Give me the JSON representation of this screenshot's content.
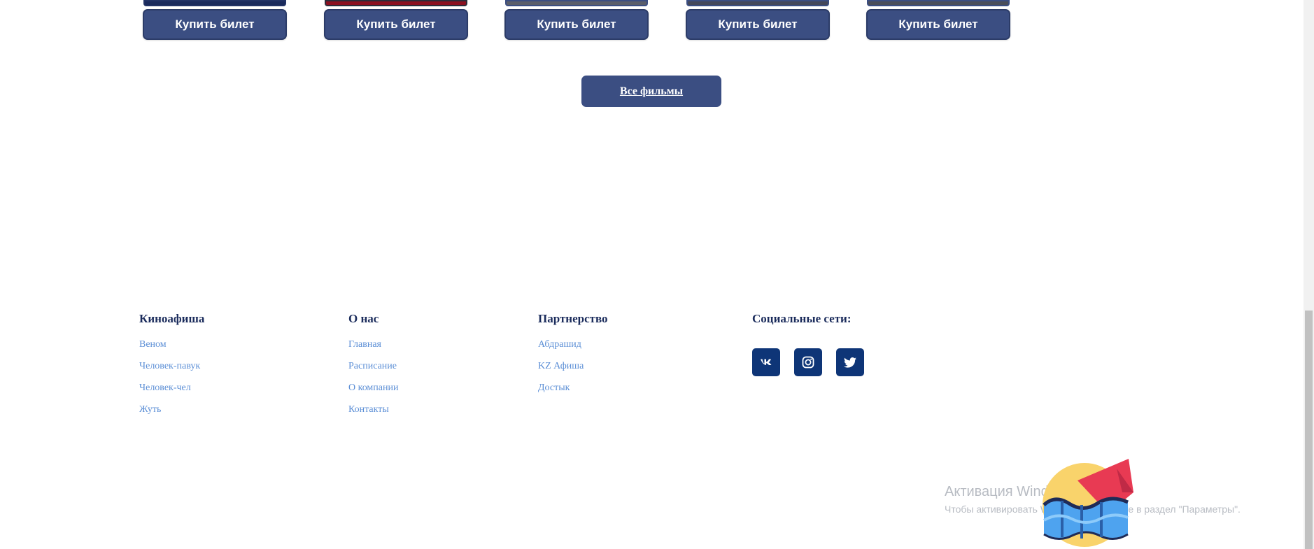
{
  "movies": {
    "buy_label": "Купить билет",
    "items": [
      {
        "poster_color": "#1a2a5c"
      },
      {
        "poster_color": "#8b1020"
      },
      {
        "poster_color": "#5a5e6a"
      },
      {
        "poster_color": "#44485a"
      },
      {
        "poster_color": "#4a4e5a"
      }
    ]
  },
  "all_films_label": "Все фильмы",
  "footer": {
    "columns": [
      {
        "title": "Киноафиша",
        "links": [
          "Веном",
          "Человек-павук",
          "Человек-чел",
          "Жуть"
        ]
      },
      {
        "title": "О нас",
        "links": [
          "Главная",
          "Расписание",
          "О компании",
          "Контакты"
        ]
      },
      {
        "title": "Партнерство",
        "links": [
          "Абдрашид",
          "KZ Афиша",
          "Достык"
        ]
      }
    ],
    "social": {
      "title": "Социальные сети:",
      "icons": [
        "vk-icon",
        "instagram-icon",
        "twitter-icon"
      ]
    }
  },
  "windows_activation": {
    "title": "Активация Windows",
    "message": "Чтобы активировать Windows, перейдите в раздел \"Параметры\"."
  },
  "colors": {
    "brand_button": "#3b4e82",
    "social_button": "#0e3577",
    "link": "#5c8fd6",
    "heading": "#1b2c5c"
  }
}
